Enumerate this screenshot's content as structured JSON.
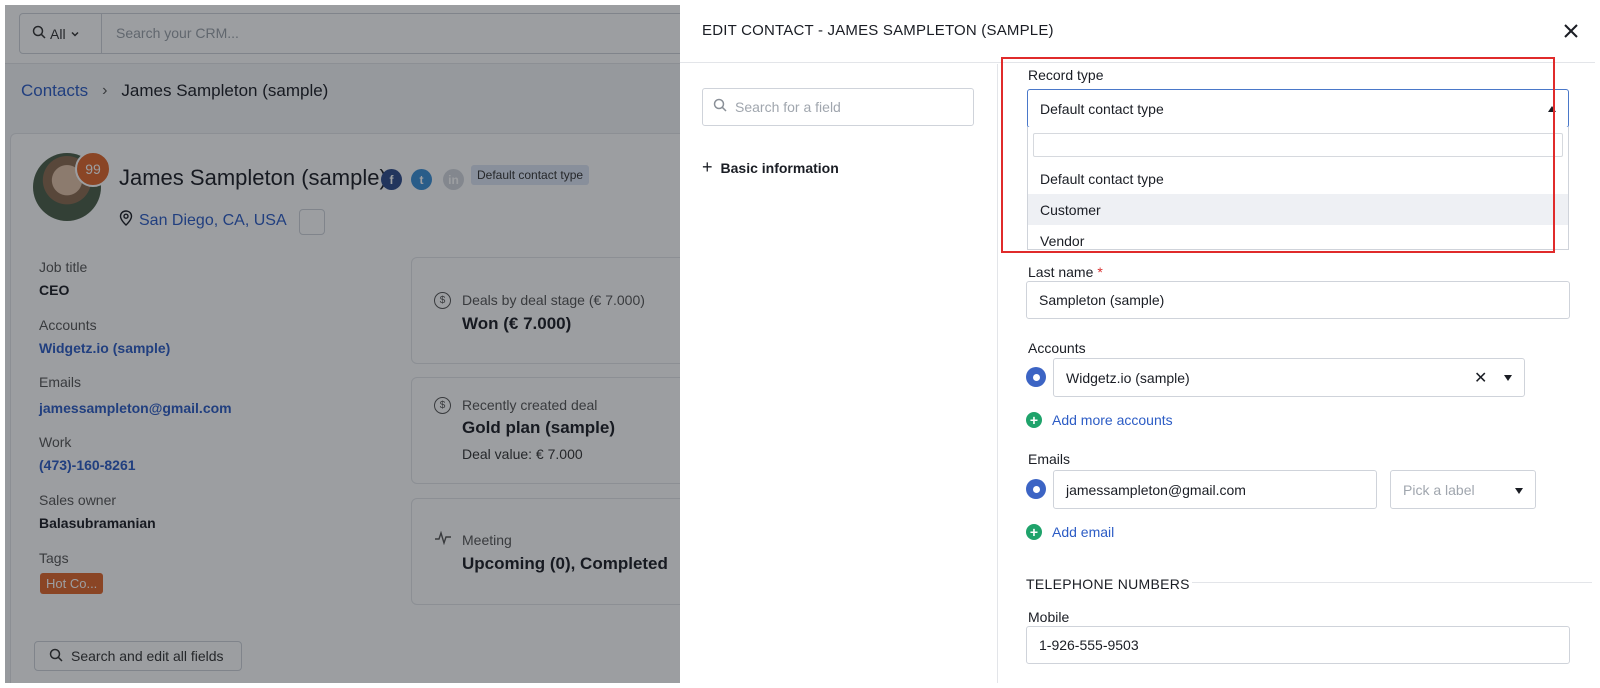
{
  "background": {
    "search": {
      "scope_label": "All",
      "placeholder": "Search your CRM..."
    },
    "breadcrumb": {
      "parent": "Contacts",
      "current": "James Sampleton (sample)"
    },
    "contact": {
      "score": "99",
      "name": "James Sampleton (sample)",
      "type_badge": "Default contact type",
      "location": "San Diego, CA, USA",
      "fields": [
        {
          "label": "Job title",
          "value": "CEO"
        },
        {
          "label": "Accounts",
          "value": "Widgetz.io (sample)"
        },
        {
          "label": "Emails",
          "value": "jamessampleton@gmail.com"
        },
        {
          "label": "Work",
          "value": "(473)-160-8261"
        },
        {
          "label": "Sales owner",
          "value": "Balasubramanian"
        },
        {
          "label": "Tags",
          "value": "Hot Co..."
        }
      ],
      "search_all_label": "Search and edit all fields"
    },
    "widgets": [
      {
        "label": "Deals by deal stage (€ 7.000)",
        "value": "Won (€ 7.000)"
      },
      {
        "label": "Recently created deal",
        "value": "Gold plan (sample)",
        "sub": "Deal value: € 7.000"
      },
      {
        "label": "Meeting",
        "value": "Upcoming (0), Completed"
      }
    ]
  },
  "panel": {
    "title": "EDIT CONTACT - JAMES SAMPLETON (SAMPLE)",
    "field_search_placeholder": "Search for a field",
    "section_nav": "Basic information",
    "record_type": {
      "label": "Record type",
      "selected": "Default contact type",
      "options": [
        "Default contact type",
        "Customer",
        "Vendor"
      ],
      "highlighted_index": 1
    },
    "last_name": {
      "label": "Last name",
      "required_mark": "*",
      "value": "Sampleton (sample)"
    },
    "accounts": {
      "label": "Accounts",
      "value": "Widgetz.io (sample)",
      "add_label": "Add more accounts"
    },
    "emails": {
      "label": "Emails",
      "value": "jamessampleton@gmail.com",
      "label_placeholder": "Pick a label",
      "add_label": "Add email"
    },
    "telephone": {
      "section": "TELEPHONE NUMBERS",
      "mobile_label": "Mobile",
      "mobile_value": "1-926-555-9503"
    }
  },
  "colors": {
    "accent_blue": "#2c5cc5",
    "highlight_red": "#e02b2b",
    "tag_orange": "#e0662a",
    "add_green": "#1fa36b"
  }
}
